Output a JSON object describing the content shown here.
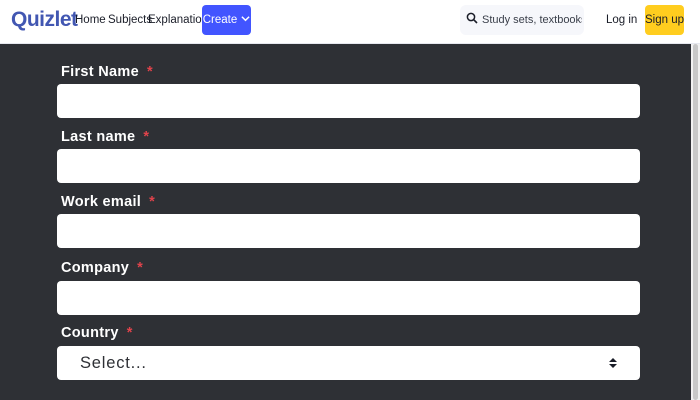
{
  "header": {
    "logo": "Quizlet",
    "nav": [
      "Home",
      "Subjects",
      "Explanations"
    ],
    "create_label": "Create",
    "search_placeholder": "Study sets, textbooks, ...",
    "login_label": "Log in",
    "signup_label": "Sign up",
    "colors": {
      "brand": "#4257b2",
      "create_bg": "#4255ff",
      "signup_bg": "#ffcd1f"
    }
  },
  "form": {
    "required_mark": "*",
    "fields": [
      {
        "label": "First Name",
        "value": ""
      },
      {
        "label": "Last name",
        "value": ""
      },
      {
        "label": "Work email",
        "value": ""
      },
      {
        "label": "Company",
        "value": ""
      }
    ],
    "country": {
      "label": "Country",
      "selected": "Select..."
    },
    "colors": {
      "background": "#2e3035",
      "required": "#e0434b"
    }
  }
}
